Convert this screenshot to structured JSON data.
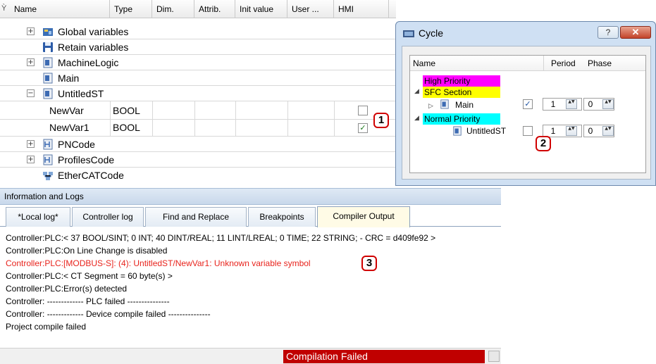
{
  "grid": {
    "columns": [
      "Name",
      "Type",
      "Dim.",
      "Attrib.",
      "Init value",
      "User ...",
      "HMI"
    ],
    "rows": [
      {
        "label": "Global variables",
        "expander": "+"
      },
      {
        "label": "Retain variables",
        "expander": ""
      },
      {
        "label": "MachineLogic",
        "expander": "+"
      },
      {
        "label": "Main",
        "expander": ""
      },
      {
        "label": "UntitledST",
        "expander": "−"
      },
      {
        "label": "NewVar",
        "type": "BOOL",
        "hmi": ""
      },
      {
        "label": "NewVar1",
        "type": "BOOL",
        "hmi": "✓"
      },
      {
        "label": "PNCode",
        "expander": "+"
      },
      {
        "label": "ProfilesCode",
        "expander": "+"
      },
      {
        "label": "EtherCATCode",
        "expander": ""
      }
    ],
    "callout": "1"
  },
  "cycle_dialog": {
    "title": "Cycle",
    "help_label": "?",
    "close_label": "✕",
    "columns": [
      "Name",
      "Period",
      "Phase"
    ],
    "high_priority": "High Priority",
    "sfc_section": "SFC Section",
    "main": {
      "label": "Main",
      "checked": "✓",
      "period": "1",
      "phase": "0"
    },
    "normal_priority": "Normal Priority",
    "untitled": {
      "label": "UntitledST",
      "checked": "",
      "period": "1",
      "phase": "0"
    },
    "spin_arrows": "▲▼",
    "callout": "2"
  },
  "logs": {
    "title": "Information and Logs",
    "tabs": [
      "*Local log*",
      "Controller log",
      "Find and Replace",
      "Breakpoints",
      "Compiler Output"
    ],
    "lines": [
      "Controller:PLC:< 37 BOOL/SINT; 0 INT; 40 DINT/REAL; 11 LINT/LREAL; 0 TIME; 22 STRING;  - CRC = d409fe92 >",
      "Controller:PLC:On Line Change is disabled",
      "Controller:PLC:[MODBUS-S]: (4): UntitledST/NewVar1: Unknown variable symbol",
      "Controller:PLC:< CT Segment = 60 byte(s) >",
      "Controller:PLC:Error(s) detected",
      "Controller: ------------- PLC failed ---------------",
      "Controller: ------------- Device compile failed ---------------",
      "Project compile failed"
    ],
    "error_color": "#e8231c",
    "callout": "3",
    "status": "Compilation Failed",
    "status_color": "#c00000"
  }
}
